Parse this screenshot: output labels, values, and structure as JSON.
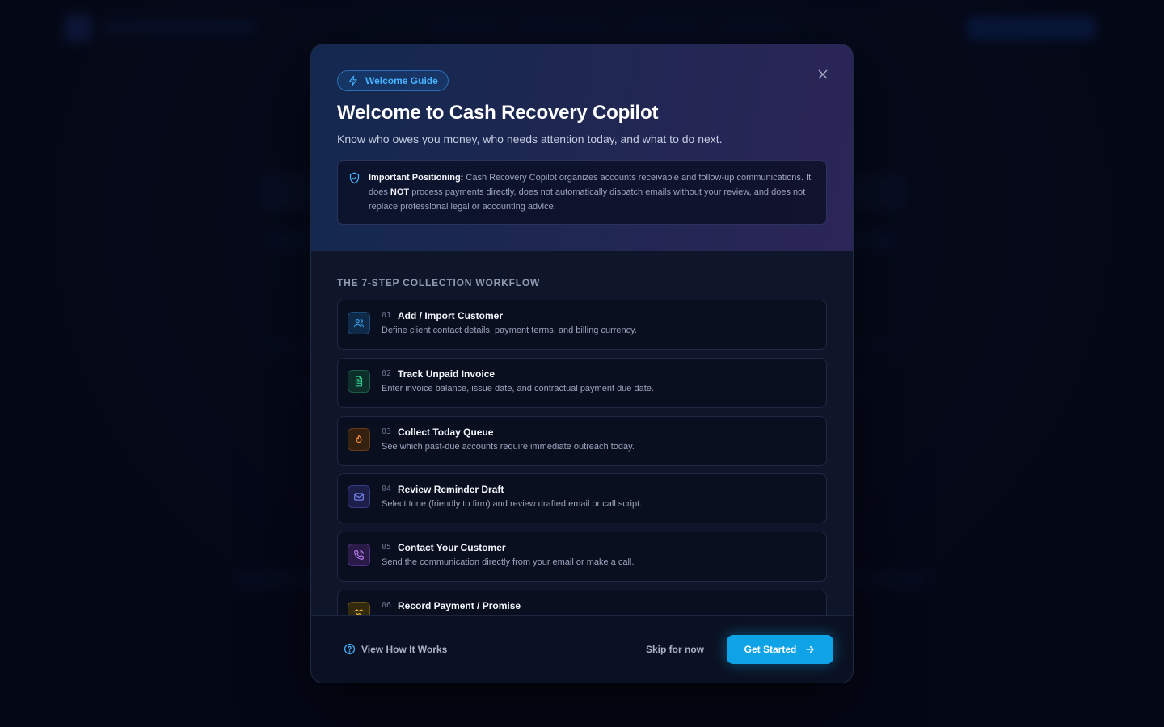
{
  "modal": {
    "badge_label": "Welcome Guide",
    "title": "Welcome to Cash Recovery Copilot",
    "subtitle": "Know who owes you money, who needs attention today, and what to do next.",
    "notice": {
      "label": "Important Positioning:",
      "text_before": " Cash Recovery Copilot organizes accounts receivable and follow-up communications. It does ",
      "emphasis": "NOT",
      "text_after": " process payments directly, does not automatically dispatch emails without your review, and does not replace professional legal or accounting advice."
    },
    "workflow_title": "THE 7-STEP COLLECTION WORKFLOW",
    "steps": [
      {
        "num": "01",
        "title": "Add / Import Customer",
        "desc": "Define client contact details, payment terms, and billing currency.",
        "icon": "users-icon",
        "color": "#3aa0e8"
      },
      {
        "num": "02",
        "title": "Track Unpaid Invoice",
        "desc": "Enter invoice balance, issue date, and contractual payment due date.",
        "icon": "file-text-icon",
        "color": "#2ec98a"
      },
      {
        "num": "03",
        "title": "Collect Today Queue",
        "desc": "See which past-due accounts require immediate outreach today.",
        "icon": "flame-icon",
        "color": "#f08a3c"
      },
      {
        "num": "04",
        "title": "Review Reminder Draft",
        "desc": "Select tone (friendly to firm) and review drafted email or call script.",
        "icon": "mail-icon",
        "color": "#7b86f5"
      },
      {
        "num": "05",
        "title": "Contact Your Customer",
        "desc": "Send the communication directly from your email or make a call.",
        "icon": "phone-call-icon",
        "color": "#b47cf0"
      },
      {
        "num": "06",
        "title": "Record Payment / Promise",
        "desc": "",
        "icon": "handshake-icon",
        "color": "#e8b53a"
      }
    ],
    "footer": {
      "help_label": "View How It Works",
      "skip_label": "Skip for now",
      "start_label": "Get Started"
    }
  },
  "colors": {
    "accent": "#0ea2e6",
    "badge": "#47b2ff"
  }
}
